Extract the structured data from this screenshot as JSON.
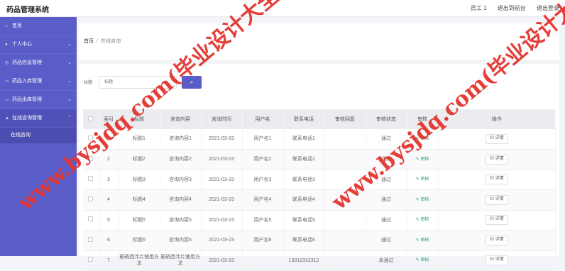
{
  "app": {
    "title": "药品管理系统"
  },
  "topbar": {
    "user": "员工 1",
    "back_to_front": "退出到前台",
    "logout": "退出登录"
  },
  "sidebar": {
    "items": [
      {
        "label": "首页",
        "icon": "home-icon"
      },
      {
        "label": "个人中心",
        "icon": "user-icon"
      },
      {
        "label": "药品信息管理",
        "icon": "info-icon"
      },
      {
        "label": "药品入库管理",
        "icon": "inbox-icon"
      },
      {
        "label": "药品出库管理",
        "icon": "outbox-icon"
      },
      {
        "label": "在线咨询管理",
        "icon": "chat-icon"
      }
    ],
    "sub_items": [
      {
        "label": "在线咨询"
      }
    ]
  },
  "breadcrumb": {
    "home": "首页",
    "separator": "/",
    "current": "在线咨询"
  },
  "search": {
    "label": "标题",
    "placeholder": "标题",
    "button_icon": "search-icon"
  },
  "table": {
    "headers": [
      "索引",
      "标题",
      "咨询内容",
      "咨询时间",
      "用户名",
      "联系电话",
      "审核回复",
      "审核状态",
      "审核",
      "操作"
    ],
    "rows": [
      {
        "index": "1",
        "title": "标题1",
        "content": "咨询内容1",
        "time": "2021-03-23",
        "username": "用户名1",
        "phone": "联系电话1",
        "reply": "",
        "status": "通过",
        "audit": "审核",
        "action": "详情"
      },
      {
        "index": "2",
        "title": "标题2",
        "content": "咨询内容2",
        "time": "2021-03-23",
        "username": "用户名2",
        "phone": "联系电话2",
        "reply": "",
        "status": "通过",
        "audit": "审核",
        "action": "详情"
      },
      {
        "index": "3",
        "title": "标题3",
        "content": "咨询内容3",
        "time": "2021-03-23",
        "username": "用户名3",
        "phone": "联系电话3",
        "reply": "",
        "status": "通过",
        "audit": "审核",
        "action": "详情"
      },
      {
        "index": "4",
        "title": "标题4",
        "content": "咨询内容4",
        "time": "2021-03-23",
        "username": "用户名4",
        "phone": "联系电话4",
        "reply": "",
        "status": "通过",
        "audit": "审核",
        "action": "详情"
      },
      {
        "index": "5",
        "title": "标题5",
        "content": "咨询内容5",
        "time": "2021-03-23",
        "username": "用户名5",
        "phone": "联系电话5",
        "reply": "",
        "status": "通过",
        "audit": "审核",
        "action": "详情"
      },
      {
        "index": "6",
        "title": "标题6",
        "content": "咨询内容6",
        "time": "2021-03-23",
        "username": "用户名6",
        "phone": "联系电话6",
        "reply": "",
        "status": "通过",
        "audit": "审核",
        "action": "详情"
      },
      {
        "index": "7",
        "title": "氯硝西泮片使用方法",
        "content": "氯硝西泮片使用方法",
        "time": "2021-03-23",
        "username": "",
        "phone": "13312312312",
        "reply": "",
        "status": "未通过",
        "audit": "审核",
        "action": "详情"
      }
    ]
  },
  "watermark": {
    "text": "www.bysjdq.com(毕业设计大全)",
    "color": "#e3342f"
  },
  "colors": {
    "sidebar": "#5a5cc8",
    "accent": "#5a5cc8",
    "audit": "#2a9d6f"
  }
}
